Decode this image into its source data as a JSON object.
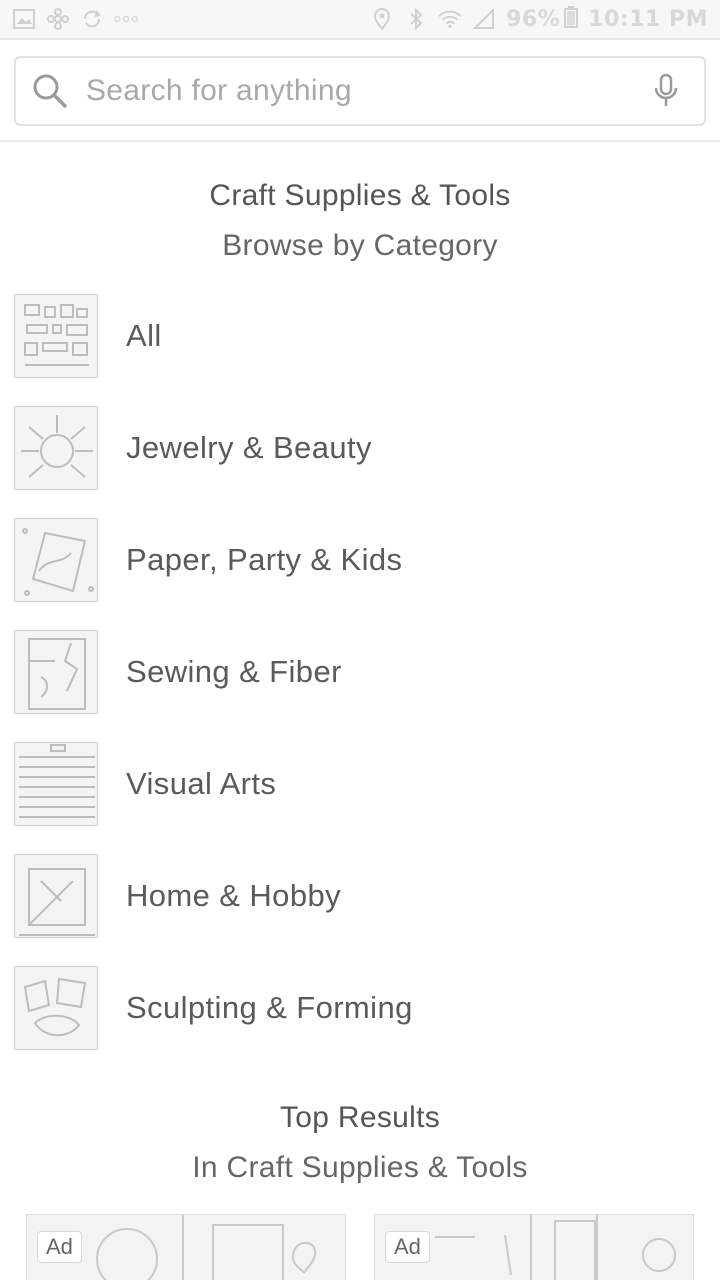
{
  "status_bar": {
    "battery": "96%",
    "time": "10:11 PM"
  },
  "search": {
    "placeholder": "Search for anything"
  },
  "category_section": {
    "title": "Craft Supplies & Tools",
    "subtitle": "Browse by Category"
  },
  "categories": [
    {
      "label": "All"
    },
    {
      "label": "Jewelry & Beauty"
    },
    {
      "label": "Paper, Party & Kids"
    },
    {
      "label": "Sewing & Fiber"
    },
    {
      "label": "Visual Arts"
    },
    {
      "label": "Home & Hobby"
    },
    {
      "label": "Sculpting & Forming"
    }
  ],
  "top_results": {
    "title": "Top Results",
    "subtitle": "In Craft Supplies & Tools",
    "cards": [
      {
        "badge": "Ad"
      },
      {
        "badge": "Ad"
      }
    ]
  }
}
